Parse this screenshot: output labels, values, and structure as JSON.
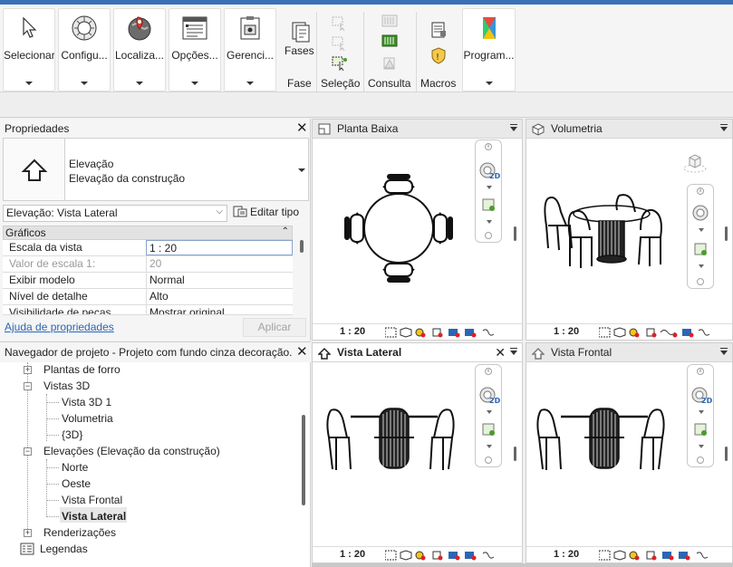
{
  "ribbon": {
    "buttons": [
      {
        "label": "Selecionar",
        "icon": "cursor-icon"
      },
      {
        "label": "Configu...",
        "icon": "sphere-icon"
      },
      {
        "label": "Localiza...",
        "icon": "globe-icon"
      },
      {
        "label": "Opções...",
        "icon": "options-icon"
      },
      {
        "label": "Gerenci...",
        "icon": "manage-icon"
      },
      {
        "label": "Program...",
        "icon": "dynamo-icon"
      }
    ],
    "groups": {
      "fases_top": "Fases",
      "fases": "Fase",
      "selecao": "Seleção",
      "consulta": "Consulta",
      "macros": "Macros"
    }
  },
  "properties": {
    "title": "Propriedades",
    "type_line1": "Elevação",
    "type_line2": "Elevação da construção",
    "view_select": "Elevação: Vista Lateral",
    "edit_type": "Editar tipo",
    "section": "Gráficos",
    "rows": [
      {
        "key": "Escala da vista",
        "value": "1 : 20"
      },
      {
        "key": "Valor de escala    1:",
        "value": "20"
      },
      {
        "key": "Exibir modelo",
        "value": "Normal"
      },
      {
        "key": "Nível de detalhe",
        "value": "Alto"
      },
      {
        "key": "Visibilidade de peças",
        "value": "Mostrar original"
      }
    ],
    "help_link": "Ajuda de propriedades",
    "apply": "Aplicar"
  },
  "browser": {
    "title": "Navegador de projeto - Projeto com fundo cinza decoração...",
    "items": [
      {
        "label": "Plantas de forro"
      },
      {
        "label": "Vistas 3D"
      },
      {
        "label": "Vista 3D 1"
      },
      {
        "label": "Volumetria"
      },
      {
        "label": "{3D}"
      },
      {
        "label": "Elevações (Elevação da construção)"
      },
      {
        "label": "Norte"
      },
      {
        "label": "Oeste"
      },
      {
        "label": "Vista Frontal"
      },
      {
        "label": "Vista Lateral"
      },
      {
        "label": "Renderizações"
      },
      {
        "label": "Legendas"
      }
    ]
  },
  "views": {
    "planta": {
      "title": "Planta Baixa",
      "scale": "1 : 20"
    },
    "volumetria": {
      "title": "Volumetria",
      "scale": "1 : 20"
    },
    "lateral": {
      "title": "Vista Lateral",
      "scale": "1 : 20"
    },
    "frontal": {
      "title": "Vista Frontal",
      "scale": "1 : 20"
    }
  },
  "navbar": {
    "label_2d": "2D"
  }
}
